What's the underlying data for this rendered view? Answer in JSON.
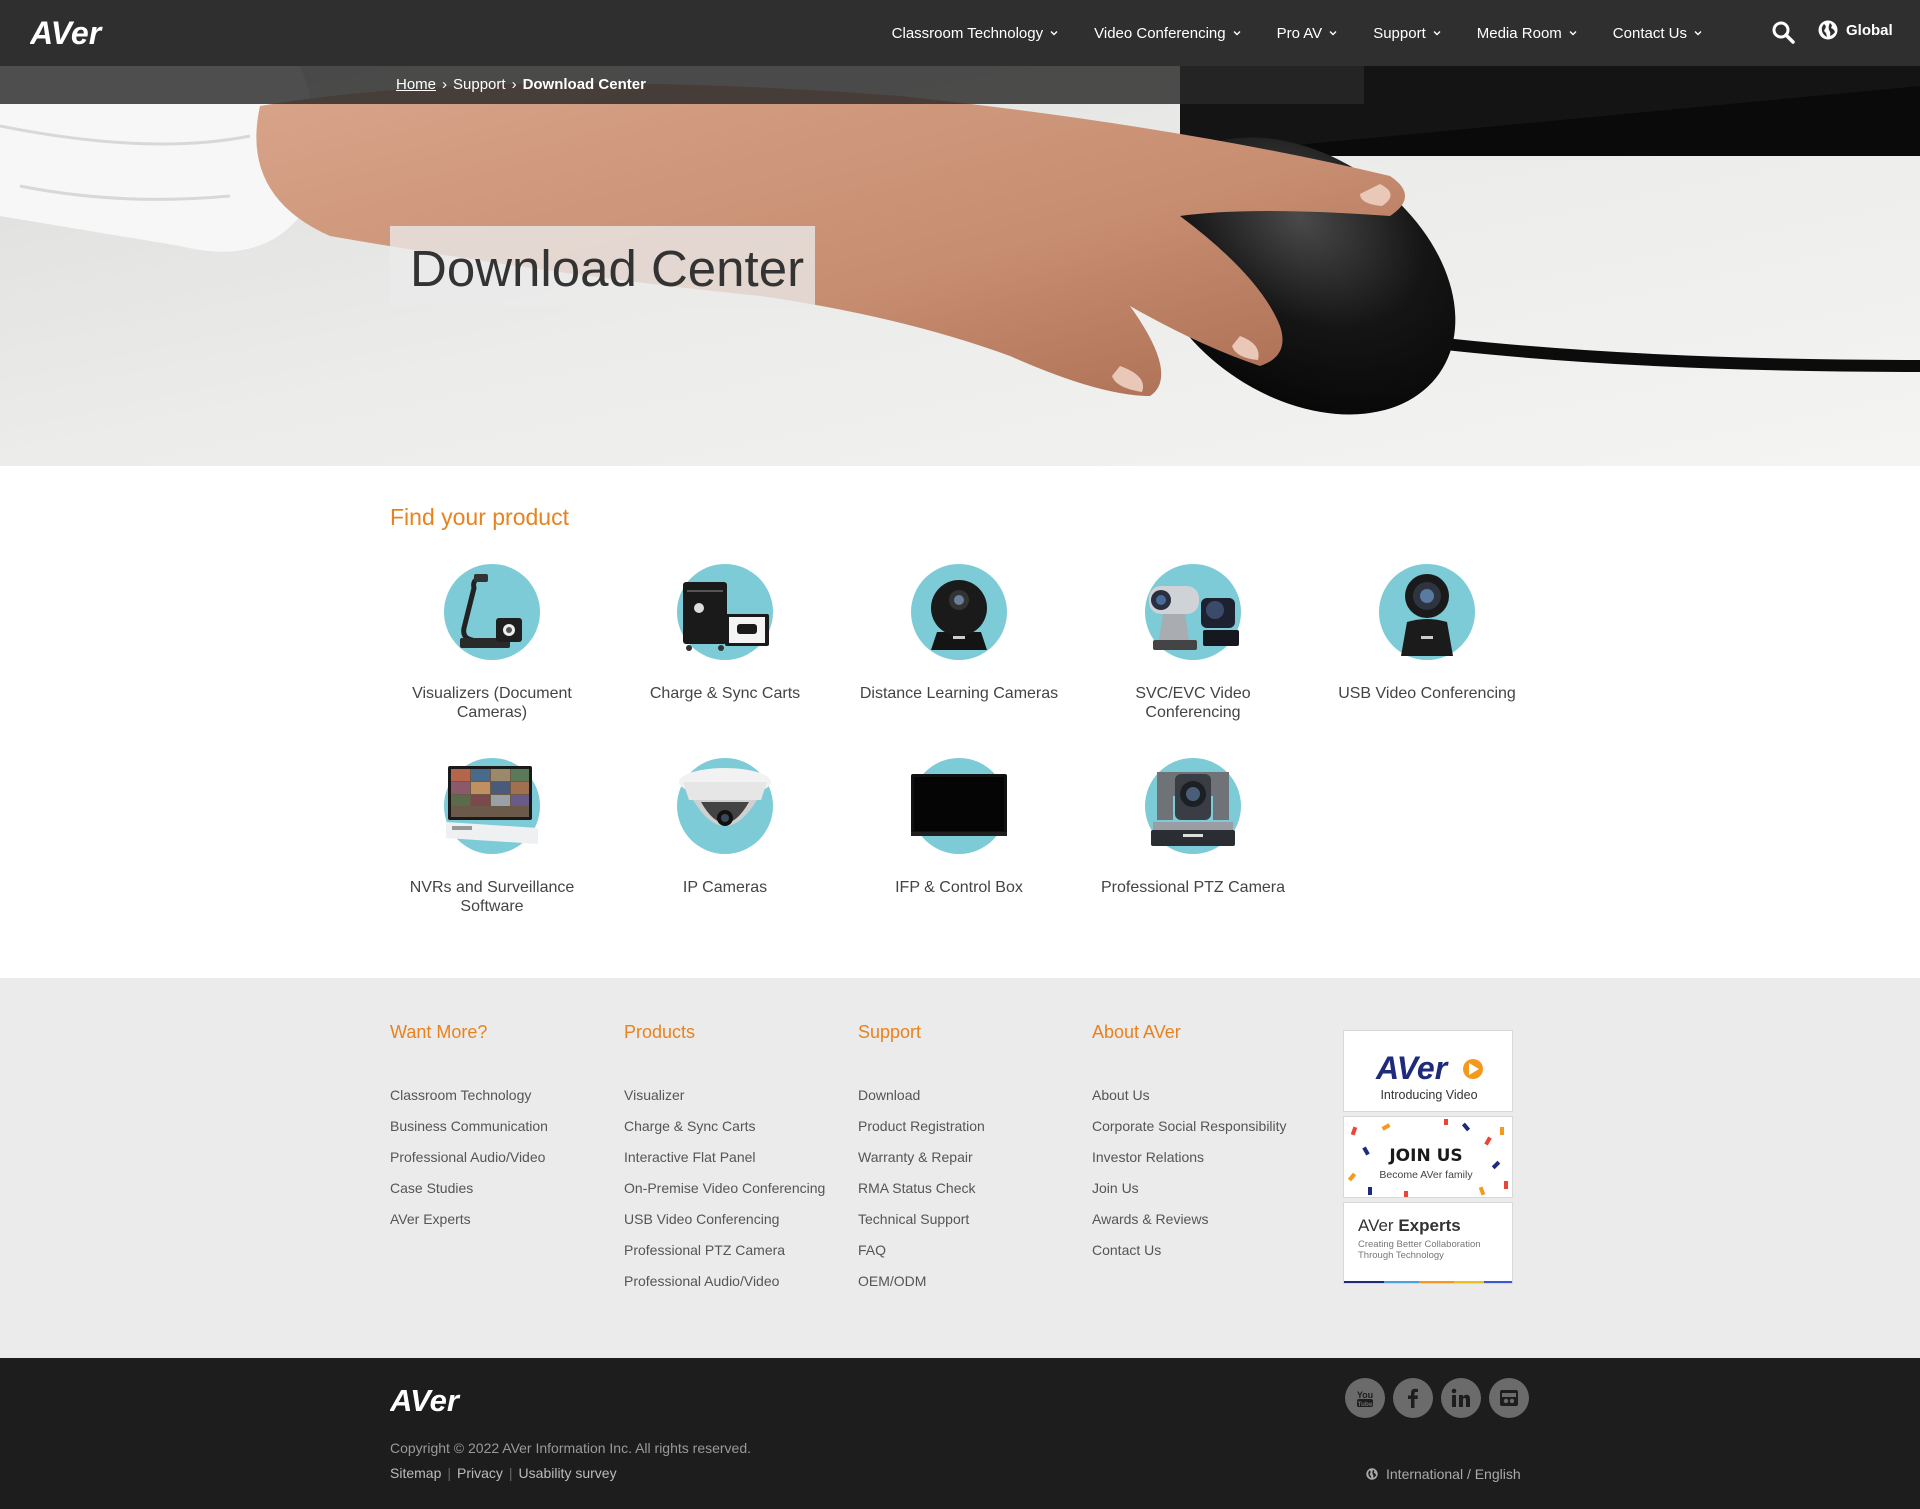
{
  "header": {
    "logo_text": "AVer",
    "nav": [
      {
        "label": "Classroom Technology"
      },
      {
        "label": "Video Conferencing"
      },
      {
        "label": "Pro AV"
      },
      {
        "label": "Support"
      },
      {
        "label": "Media Room"
      },
      {
        "label": "Contact Us"
      }
    ],
    "global_label": "Global"
  },
  "breadcrumb": {
    "home": "Home",
    "sep1": "›",
    "support": "Support",
    "sep2": "›",
    "current": "Download Center"
  },
  "hero": {
    "title": "Download Center"
  },
  "products": {
    "heading": "Find your product",
    "items": [
      {
        "label": "Visualizers (Document Cameras)",
        "icon": "document-camera-icon"
      },
      {
        "label": "Charge & Sync Carts",
        "icon": "charging-cart-icon"
      },
      {
        "label": "Distance Learning Cameras",
        "icon": "webcam-icon"
      },
      {
        "label": "SVC/EVC Video Conferencing",
        "icon": "conference-camera-icon"
      },
      {
        "label": "USB Video Conferencing",
        "icon": "usb-camera-icon"
      },
      {
        "label": "NVRs and Surveillance Software",
        "icon": "nvr-icon"
      },
      {
        "label": "IP Cameras",
        "icon": "dome-camera-icon"
      },
      {
        "label": "IFP & Control Box",
        "icon": "flat-panel-icon"
      },
      {
        "label": "Professional PTZ Camera",
        "icon": "ptz-camera-icon"
      }
    ]
  },
  "footer": {
    "columns": [
      {
        "heading": "Want More?",
        "links": [
          "Classroom Technology",
          "Business Communication",
          "Professional Audio/Video",
          "Case Studies",
          "AVer Experts"
        ]
      },
      {
        "heading": "Products",
        "links": [
          "Visualizer",
          "Charge & Sync Carts",
          "Interactive Flat Panel",
          "On-Premise Video Conferencing",
          "USB Video Conferencing",
          "Professional PTZ Camera",
          "Professional Audio/Video"
        ]
      },
      {
        "heading": "Support",
        "links": [
          "Download",
          "Product Registration",
          "Warranty & Repair",
          "RMA Status Check",
          "Technical Support",
          "FAQ",
          "OEM/ODM"
        ]
      },
      {
        "heading": "About AVer",
        "links": [
          "About Us",
          "Corporate Social Responsibility",
          "Investor Relations",
          "Join Us",
          "Awards & Reviews",
          "Contact Us"
        ]
      }
    ],
    "banners": {
      "video": {
        "brand": "AVer",
        "caption": "Introducing Video"
      },
      "join": {
        "title": "JOIN US",
        "caption": "Become AVer family"
      },
      "experts": {
        "title_a": "AVer",
        "title_b": "Experts",
        "caption_1": "Creating Better Collaboration",
        "caption_2": "Through Technology"
      }
    }
  },
  "bottom": {
    "logo_text": "AVer",
    "copyright": "Copyright © 2022 AVer Information Inc. All rights reserved.",
    "links": [
      "Sitemap",
      "Privacy",
      "Usability survey"
    ],
    "separator": "|",
    "language": "International / English",
    "social": [
      "youtube-icon",
      "facebook-icon",
      "linkedin-icon",
      "flickr-icon"
    ]
  },
  "colors": {
    "accent_orange": "#e8821e",
    "nav_bg": "#2f2f2f",
    "footer_bg": "#ebebeb",
    "bottom_bg": "#1d1d1d",
    "icon_circle": "#7ccbd6"
  }
}
